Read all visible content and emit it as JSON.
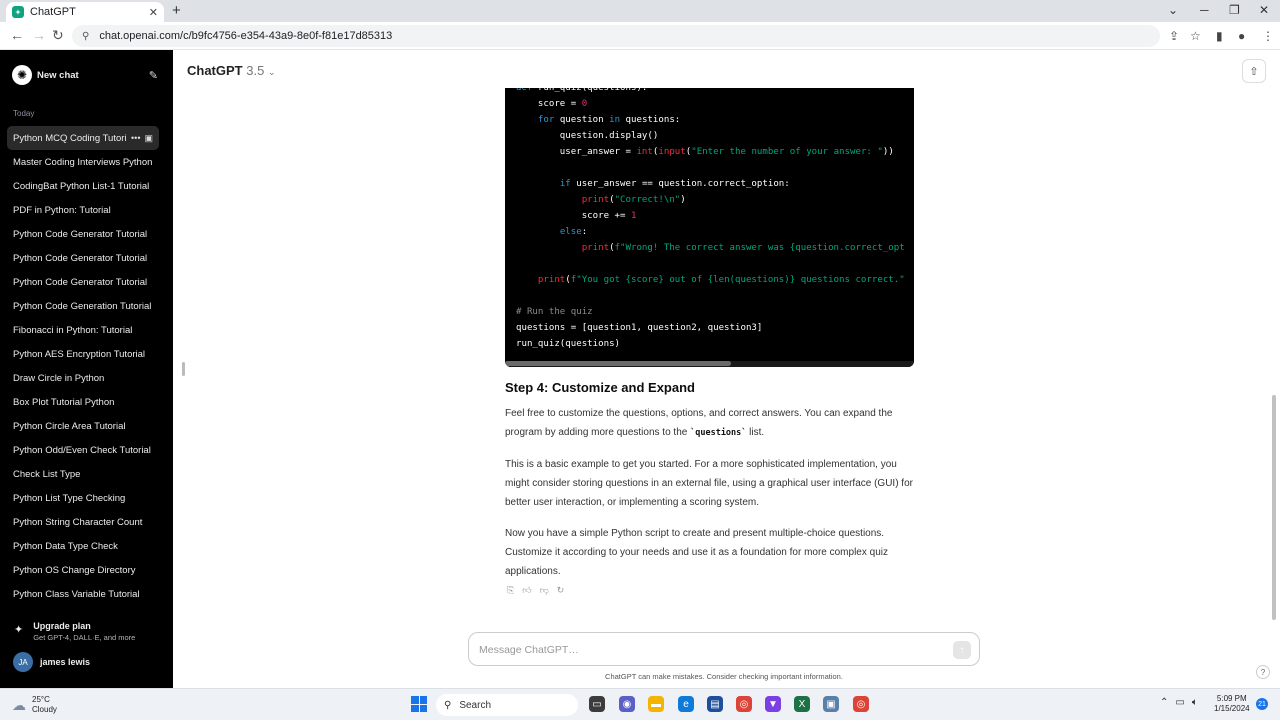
{
  "browser": {
    "tab_title": "ChatGPT",
    "url": "chat.openai.com/c/b9fc4756-e354-43a9-8e0f-f81e17d85313"
  },
  "sidebar": {
    "new_chat_label": "New chat",
    "section_today": "Today",
    "items": [
      {
        "label": "Python MCQ Coding Tutorial"
      },
      {
        "label": "Master Coding Interviews Python"
      },
      {
        "label": "CodingBat Python List-1 Tutorial"
      },
      {
        "label": "PDF in Python: Tutorial"
      },
      {
        "label": "Python Code Generator Tutorial"
      },
      {
        "label": "Python Code Generator Tutorial"
      },
      {
        "label": "Python Code Generator Tutorial"
      },
      {
        "label": "Python Code Generation Tutorial"
      },
      {
        "label": "Fibonacci in Python: Tutorial"
      },
      {
        "label": "Python AES Encryption Tutorial"
      },
      {
        "label": "Draw Circle in Python"
      },
      {
        "label": "Box Plot Tutorial Python"
      },
      {
        "label": "Python Circle Area Tutorial"
      },
      {
        "label": "Python Odd/Even Check Tutorial"
      },
      {
        "label": "Check List Type"
      },
      {
        "label": "Python List Type Checking"
      },
      {
        "label": "Python String Character Count"
      },
      {
        "label": "Python Data Type Check"
      },
      {
        "label": "Python OS Change Directory"
      },
      {
        "label": "Python Class Variable Tutorial"
      }
    ],
    "upgrade_title": "Upgrade plan",
    "upgrade_subtitle": "Get GPT-4, DALL·E, and more",
    "user_initials": "JA",
    "user_name": "james lewis"
  },
  "header": {
    "model_name": "ChatGPT",
    "model_version": "3.5"
  },
  "code": {
    "lines": [
      "def run_quiz(questions):",
      "    score = 0",
      "    for question in questions:",
      "        question.display()",
      "        user_answer = int(input(\"Enter the number of your answer: \"))",
      "",
      "        if user_answer == question.correct_option:",
      "            print(\"Correct!\\n\")",
      "            score += 1",
      "        else:",
      "            print(f\"Wrong! The correct answer was {question.correct_opt",
      "",
      "    print(f\"You got {score} out of {len(questions)} questions correct.\"",
      "",
      "# Run the quiz",
      "questions = [question1, question2, question3]",
      "run_quiz(questions)"
    ]
  },
  "content": {
    "step4_heading": "Step 4: Customize and Expand",
    "para1_before": "Feel free to customize the questions, options, and correct answers. You can expand the program by adding more questions to the ",
    "para1_code": "`questions`",
    "para1_after": " list.",
    "para2": "This is a basic example to get you started. For a more sophisticated implementation, you might consider storing questions in an external file, using a graphical user interface (GUI) for better user interaction, or implementing a scoring system.",
    "para3": "Now you have a simple Python script to create and present multiple-choice questions. Customize it according to your needs and use it as a foundation for more complex quiz applications."
  },
  "composer": {
    "placeholder": "Message ChatGPT…",
    "disclaimer": "ChatGPT can make mistakes. Consider checking important information."
  },
  "taskbar": {
    "weather_temp": "25°C",
    "weather_desc": "Cloudy",
    "search_label": "Search",
    "time": "5:09 PM",
    "date": "1/15/2024",
    "notification_count": "21"
  }
}
